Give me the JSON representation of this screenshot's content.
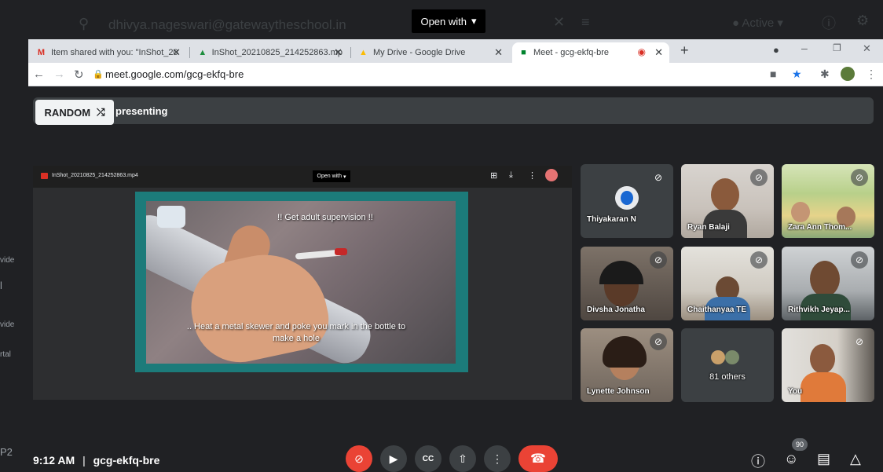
{
  "shell": {
    "email": "dhivya.nageswari@gatewaytheschool.in",
    "open_with": "Open with",
    "status": "Active"
  },
  "tabs": [
    {
      "title": "Item shared with you: \"InShot_20",
      "favicon": "gmail-icon"
    },
    {
      "title": "InShot_20210825_214252863.mp",
      "favicon": "drive-icon"
    },
    {
      "title": "My Drive - Google Drive",
      "favicon": "drive-icon"
    },
    {
      "title": "Meet - gcg-ekfq-bre",
      "favicon": "meet-icon"
    }
  ],
  "address": {
    "url": "meet.google.com/gcg-ekfq-bre"
  },
  "presenting": {
    "random_label": "RANDOM",
    "text": "presenting"
  },
  "presentation": {
    "filename": "InShot_20210825_214252863.mp4",
    "open_with": "Open with",
    "caption_top": "!! Get adult supervision !!",
    "caption_bottom": ".. Heat a metal skewer and poke you mark in the bottle to make a hole"
  },
  "participants": [
    {
      "name": "Thiyakaran N",
      "muted": true
    },
    {
      "name": "Ryan Balaji",
      "muted": true
    },
    {
      "name": "Zara Ann Thom...",
      "muted": true
    },
    {
      "name": "Divsha Jonatha",
      "muted": true
    },
    {
      "name": "Chaithanyaa TE",
      "muted": true
    },
    {
      "name": "Rithvikh Jeyap...",
      "muted": true
    },
    {
      "name": "Lynette Johnson",
      "muted": true
    },
    {
      "name": "81 others",
      "muted": false
    },
    {
      "name": "You",
      "muted": true
    }
  ],
  "footer": {
    "time": "9:12 AM",
    "separator": "|",
    "meeting_code": "gcg-ekfq-bre",
    "people_count": "90"
  },
  "left_fragments": [
    "vide",
    "l",
    "vide",
    "rtal",
    "P2"
  ],
  "colors": {
    "meet_bg": "#202124",
    "tile_bg": "#3c4043",
    "hangup_red": "#ea4335",
    "slide_border": "#1c7b7a"
  }
}
